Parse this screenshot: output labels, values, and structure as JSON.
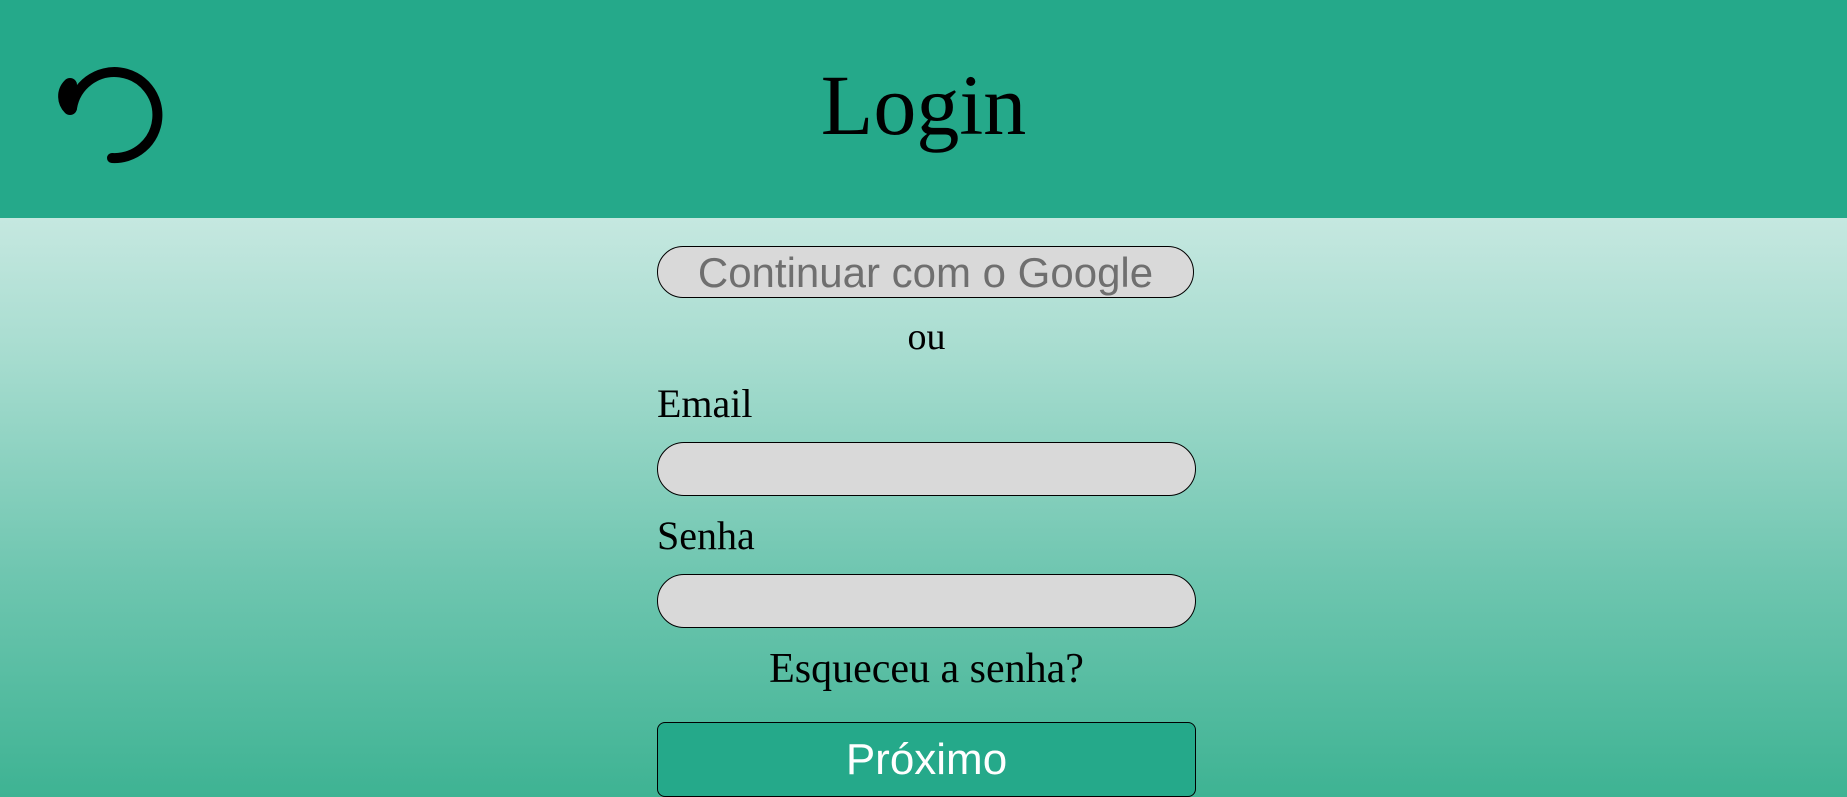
{
  "header": {
    "title": "Login",
    "logo_icon": "spinner-arc-icon",
    "background_color": "#25a98a"
  },
  "form": {
    "google_button_label": "Continuar com o Google",
    "divider_text": "ou",
    "email_label": "Email",
    "email_value": "",
    "email_placeholder": "",
    "password_label": "Senha",
    "password_value": "",
    "password_placeholder": "",
    "forgot_password_text": "Esqueceu a senha?",
    "next_button_label": "Próximo",
    "input_background_color": "#d9d9d9",
    "primary_button_color": "#25a98a"
  }
}
